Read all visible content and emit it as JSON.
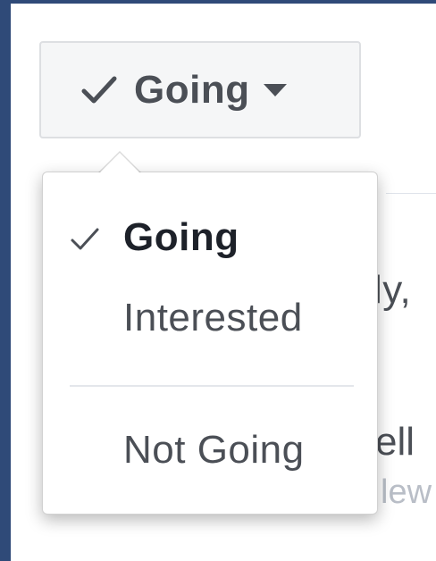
{
  "button": {
    "label": "Going",
    "check_icon": "check-icon",
    "caret_icon": "caret-down-icon"
  },
  "menu": {
    "items": [
      {
        "label": "Going",
        "selected": true
      },
      {
        "label": "Interested",
        "selected": false
      },
      {
        "label": "Not Going",
        "selected": false
      }
    ]
  },
  "background": {
    "line1": "ly,",
    "line2": "ell",
    "line3": "lew"
  },
  "colors": {
    "page_frame": "#2f4a78",
    "text": "#4b4f56",
    "text_strong": "#1d2129",
    "button_bg": "#f5f6f7"
  }
}
